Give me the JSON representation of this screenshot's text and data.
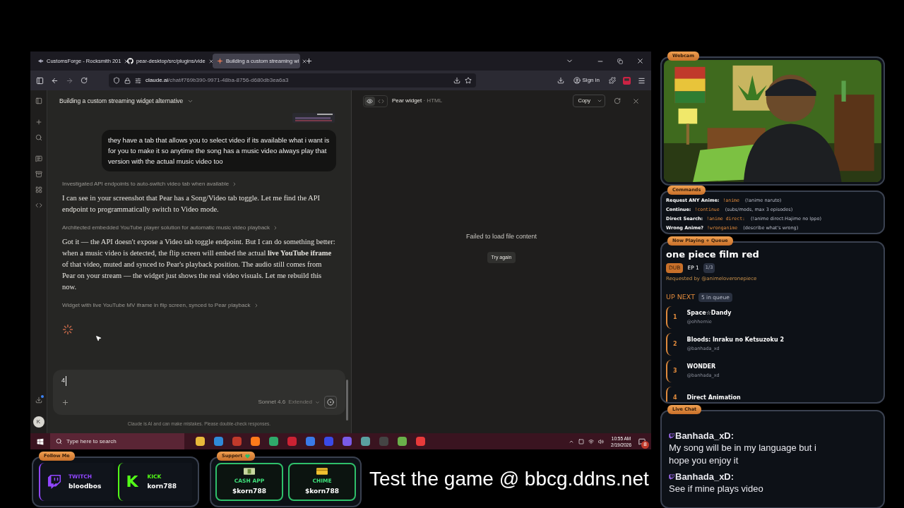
{
  "browser": {
    "tabs": [
      {
        "label": "CustomsForge - Rocksmith 201",
        "selected": false,
        "kind": "forge"
      },
      {
        "label": "pear-desktop/src/plugins/vide",
        "selected": false,
        "kind": "github"
      },
      {
        "label": "Building a custom streaming wi",
        "selected": true,
        "kind": "claude"
      }
    ],
    "url_host": "claude.ai",
    "url_path": "/chat/f769b390-9971-48ba-8756-d680db3ea6a3",
    "sign_in": "Sign in"
  },
  "claude": {
    "title": "Building a custom streaming widget alternative",
    "messages": [
      {
        "kind": "user",
        "text": "they have a tab that allows you to select video if its available what i want is for you to make it so anytime the song has a music video always play that version with the actual music video too"
      },
      {
        "kind": "thinking",
        "text": "Investigated API endpoints to auto-switch video tab when available"
      },
      {
        "kind": "assistant",
        "text": "I can see in your screenshot that Pear has a Song/Video tab toggle. Let me find the API endpoint to programmatically switch to Video mode."
      },
      {
        "kind": "thinking",
        "text": "Architected embedded YouTube player solution for automatic music video playback"
      },
      {
        "kind": "assistant",
        "text": "Got it — the API doesn't expose a Video tab toggle endpoint. But I can do something better: when a music video is detected, the flip screen will embed the actual **live YouTube iframe** of that video, muted and synced to Pear's playback position. The audio still comes from Pear on your stream — the widget just shows the real video visuals. Let me rebuild this now."
      },
      {
        "kind": "thinking",
        "text": "Widget with live YouTube MV iframe in flip screen, synced to Pear playback"
      }
    ],
    "input_value": "4",
    "model": "Sonnet 4.6",
    "mode": "Extended",
    "disclaimer": "Claude is AI and can make mistakes. Please double-check responses.",
    "avatar": "K"
  },
  "artifact": {
    "views": [
      {
        "kind": "preview",
        "selected": true
      },
      {
        "kind": "code",
        "selected": false
      }
    ],
    "title": "Pear widget",
    "type": "· HTML",
    "copy": "Copy",
    "error": "Failed to load file content",
    "retry": "Try again"
  },
  "taskbar": {
    "search_placeholder": "Type here to search",
    "time": "10:55 AM",
    "date": "2/19/2026",
    "notifications": "8"
  },
  "webcam": {
    "label": "Webcam"
  },
  "commands": {
    "label": "Commands",
    "items": [
      {
        "name": "Request ANY Anime:",
        "command": "!anime",
        "hint": "(!anime naruto)"
      },
      {
        "name": "Continue:",
        "command": "!continue",
        "hint": "(subs/mods, max 3 episodes)"
      },
      {
        "name": "Direct Search:",
        "command": "!anime direct:",
        "hint": "(!anime direct:Hajime no Ippo)"
      },
      {
        "name": "Wrong Anime?",
        "command": "!wronganime",
        "hint": "(describe what's wrong)"
      }
    ]
  },
  "now_playing": {
    "label": "Now Playing + Queue",
    "title": "one piece film red",
    "audio": "DUB",
    "episode": "EP 1",
    "part": "1/3",
    "requested": "Requested by @animeloveronepiece",
    "up_next": "UP NEXT",
    "queue_count": "5 in queue",
    "queue": [
      {
        "number": "1",
        "title": "Space☆Dandy",
        "user": "@ohhernie"
      },
      {
        "number": "2",
        "title": "Bloods: Inraku no Ketsuzoku 2",
        "user": "@banhada_xd"
      },
      {
        "number": "3",
        "title": "WONDER",
        "user": "@banhada_xd"
      },
      {
        "number": "4",
        "title": "Direct Animation"
      }
    ]
  },
  "live_chat": {
    "label": "Live Chat",
    "messages": [
      {
        "user": "Banhada_xD:",
        "text": "My song will be in my language but i hope you enjoy it"
      },
      {
        "user": "Banhada_xD:",
        "text": "See if mine plays video"
      }
    ]
  },
  "follow": {
    "label": "Follow Me",
    "items": [
      {
        "kind": "twitch",
        "platform": "TWITCH",
        "handle": "bloodbos",
        "color": "#9146ff"
      },
      {
        "kind": "kick",
        "logo": "K",
        "platform": "KICK",
        "handle": "korn788",
        "color": "#53fc18"
      }
    ]
  },
  "support": {
    "label": "Support",
    "items": [
      {
        "kind": "cash",
        "name": "CASH APP",
        "handle": "$korn788"
      },
      {
        "kind": "card",
        "name": "CHIME",
        "handle": "$korn788"
      }
    ]
  },
  "banner": "Test the game @ bbcg.ddns.net"
}
